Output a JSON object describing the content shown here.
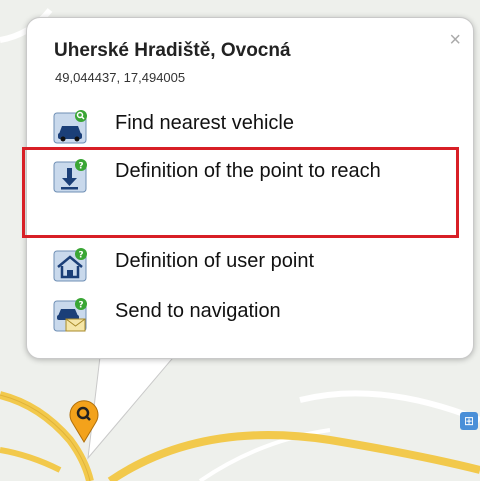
{
  "popup": {
    "title": "Uherské Hradiště, Ovocná",
    "coordinates": "49,044437, 17,494005",
    "close_icon": "×"
  },
  "menu": [
    {
      "label": "Find nearest vehicle",
      "icon": "car-search-icon"
    },
    {
      "label": "Definition of the point to reach",
      "icon": "download-point-icon"
    },
    {
      "label": "Definition of user point",
      "icon": "home-point-icon"
    },
    {
      "label": "Send to navigation",
      "icon": "car-mail-icon"
    }
  ],
  "colors": {
    "highlight_border": "#d81f26",
    "road_yellow": "#f2c94c",
    "pin_orange": "#f3a21b"
  }
}
